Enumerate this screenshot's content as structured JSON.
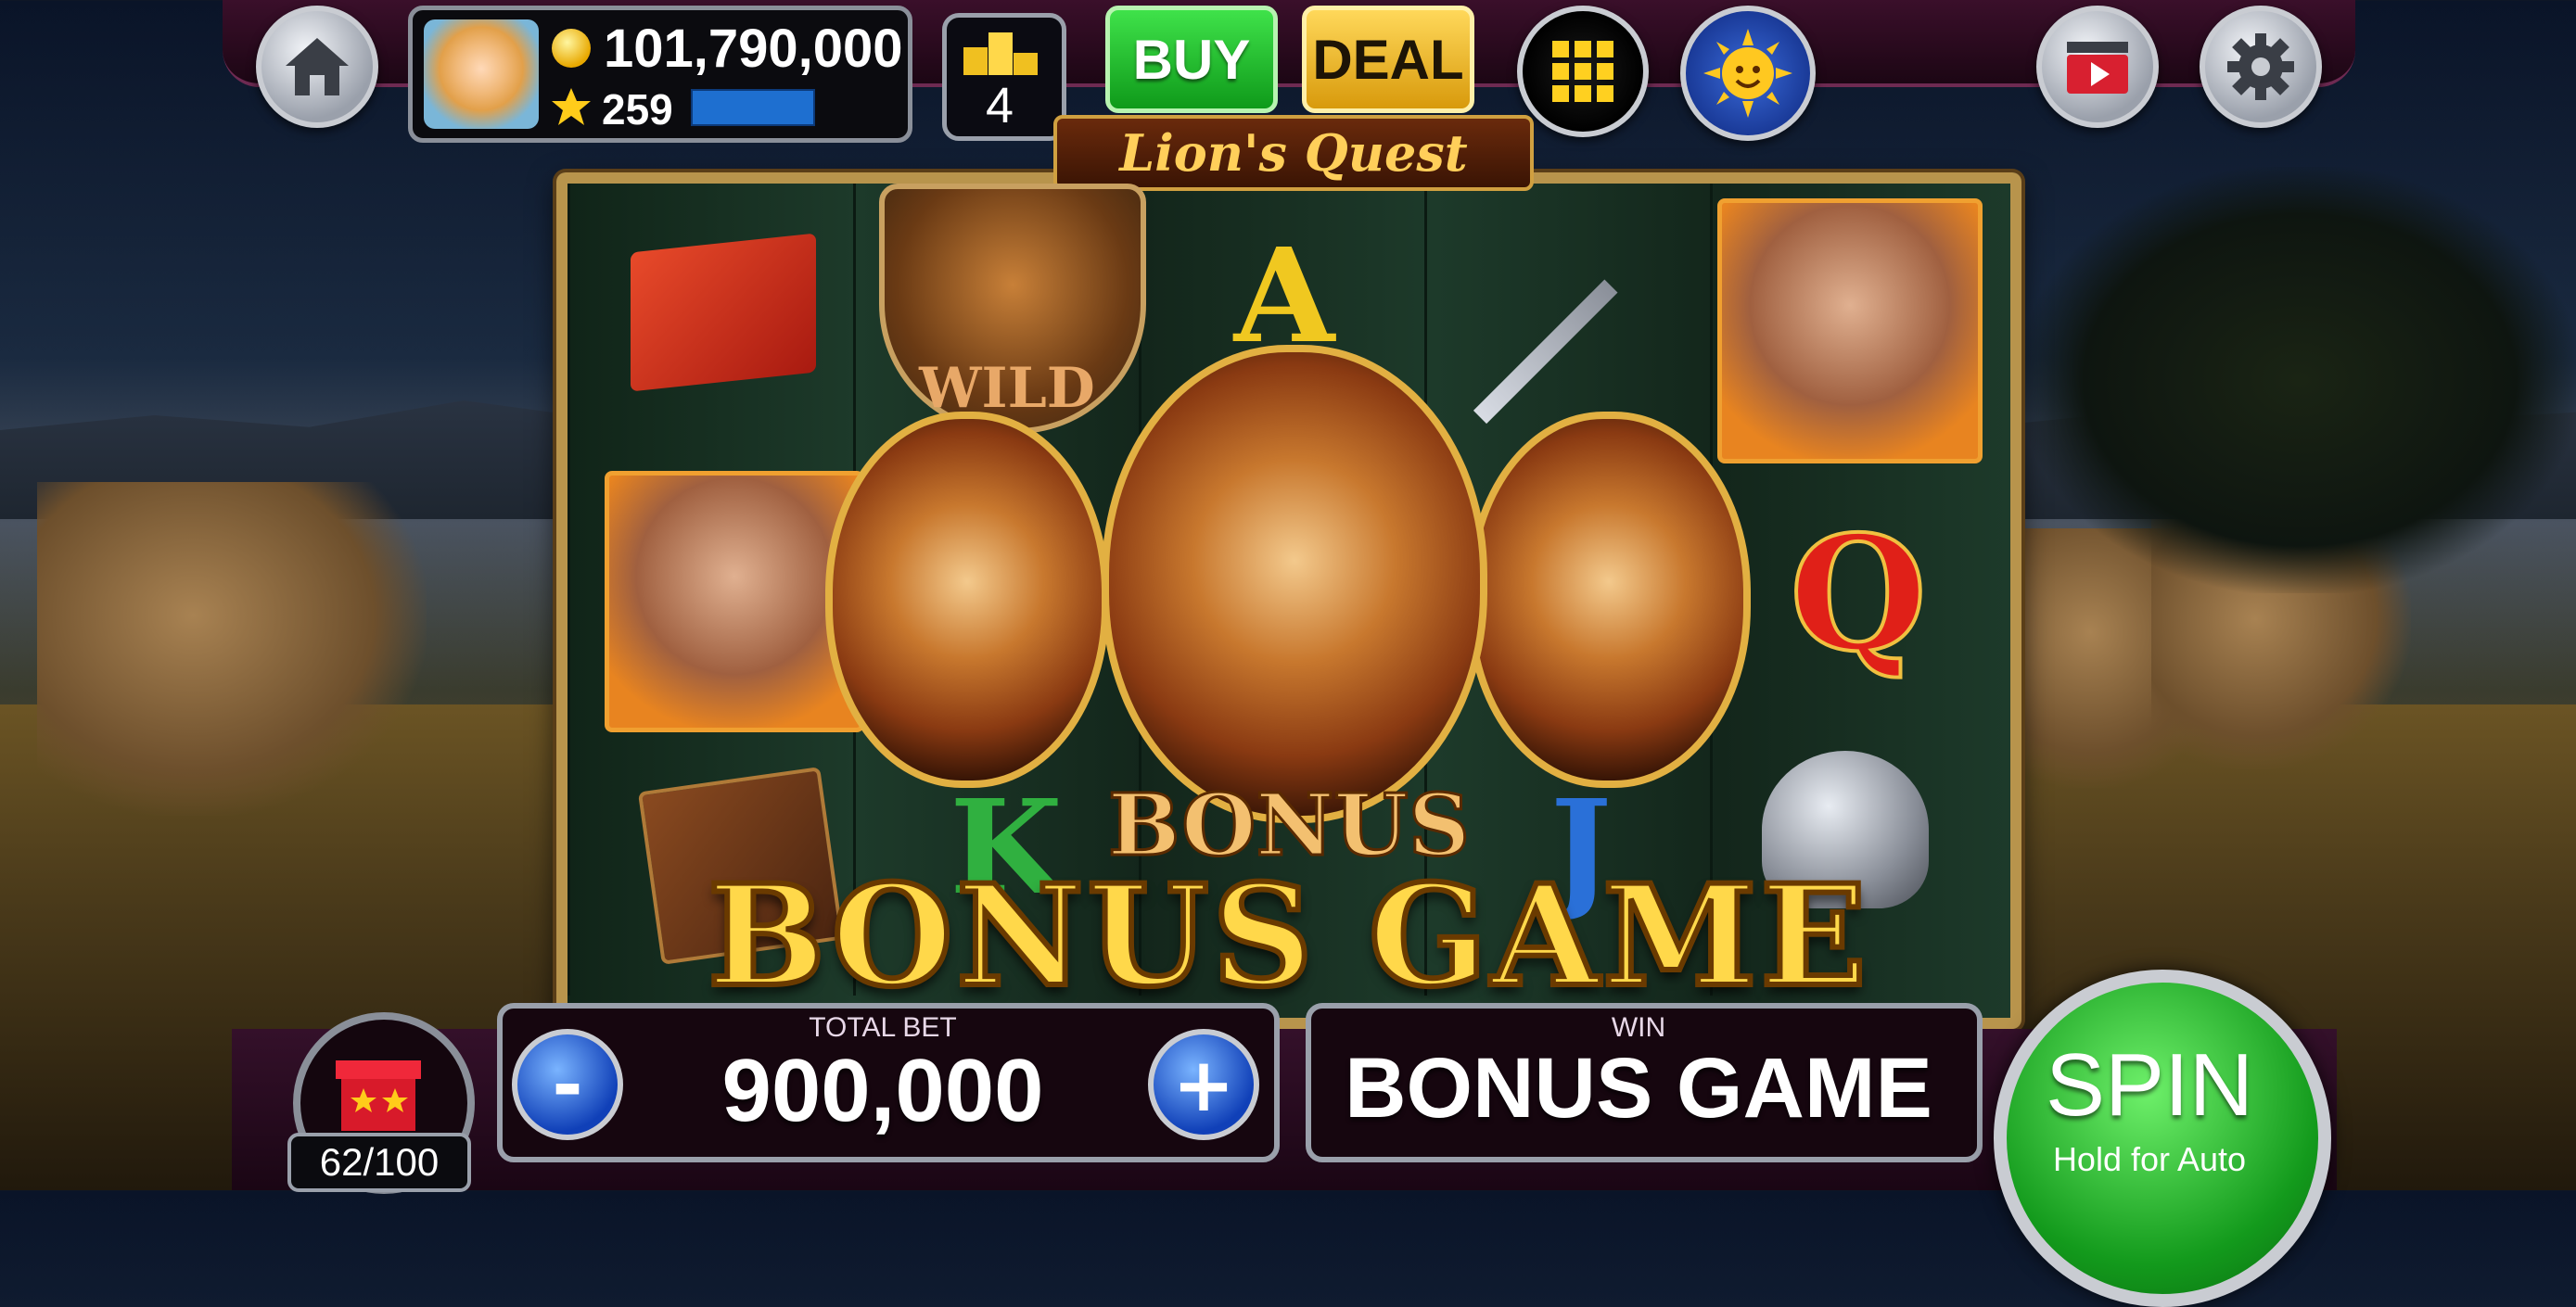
{
  "game": {
    "title": "Lion's Quest",
    "bonus_banner": "BONUS GAME",
    "bonus_symbol_text": "BONUS",
    "wild_text": "WILD"
  },
  "player": {
    "coins": "101,790,000",
    "stars": "259",
    "xp_progress": 0.72,
    "level": "4",
    "podium_numbers": [
      "2",
      "1",
      "3"
    ]
  },
  "top_buttons": {
    "buy_label": "BUY",
    "deal_label": "DEAL"
  },
  "symbols": {
    "queen": "Q",
    "king": "K",
    "jack": "J",
    "ace": "A"
  },
  "bet": {
    "label": "TOTAL BET",
    "value": "900,000",
    "minus": "-",
    "plus": "+"
  },
  "win": {
    "label": "WIN",
    "value": "BONUS GAME"
  },
  "spin": {
    "label": "SPIN",
    "sub_label": "Hold for Auto"
  },
  "gift": {
    "count": "62/100"
  },
  "icons": [
    "home-icon",
    "coin-icon",
    "star-icon",
    "podium-icon",
    "grid-icon",
    "sun-icon",
    "video-icon",
    "gear-icon",
    "gift-icon"
  ],
  "colors": {
    "buy": "#1fbf2a",
    "deal": "#f0b020",
    "spin": "#22c02a",
    "gold_text": "#ffd84a",
    "xp_bar": "#1e6fd0"
  }
}
